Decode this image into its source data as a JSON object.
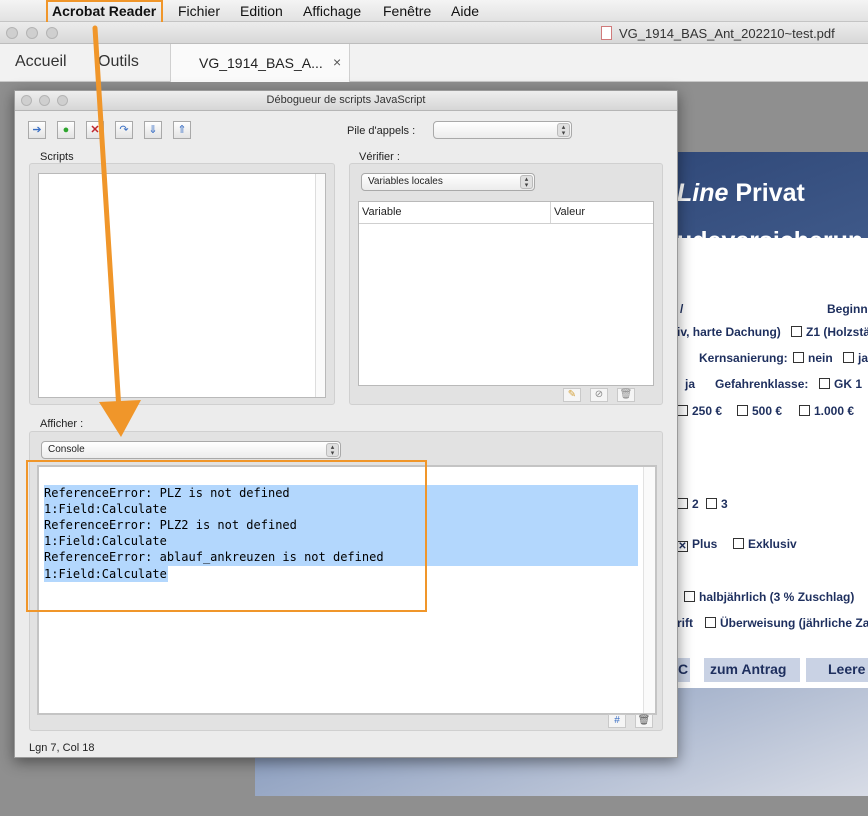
{
  "menubar": {
    "apple_icon": "apple-icon",
    "app_name": "Acrobat Reader",
    "items": [
      "Fichier",
      "Edition",
      "Affichage",
      "Fenêtre",
      "Aide"
    ]
  },
  "window": {
    "file_title": "VG_1914_BAS_Ant_202210~test.pdf"
  },
  "toolbar": {
    "home": "Accueil",
    "tools": "Outils",
    "doc_tab": "VG_1914_BAS_A...",
    "close": "×"
  },
  "debugger": {
    "title": "Débogueur de scripts JavaScript",
    "call_stack_label": "Pile d'appels :",
    "call_stack_value": "",
    "scripts_label": "Scripts",
    "verify_label": "Vérifier :",
    "verify_select": "Variables locales",
    "table_headers": [
      "Variable",
      "Valeur"
    ],
    "show_label": "Afficher :",
    "show_select": "Console",
    "console_lines": [
      "ReferenceError: PLZ is not defined",
      "1:Field:Calculate",
      "ReferenceError: PLZ2 is not defined",
      "1:Field:Calculate",
      "ReferenceError: ablauf_ankreuzen is not defined",
      "1:Field:Calculate"
    ],
    "status": "Lgn 7, Col 18"
  },
  "pdf": {
    "title1_italic": "Line",
    "title1_rest": " Privat",
    "title2": "udeversicherun",
    "row_slash": "/",
    "row_begin": "Beginn",
    "roof": "iv, harte Dachung)",
    "z1": "Z1 (Holzstä",
    "kern": "Kernsanierung:",
    "nein": "nein",
    "ja": "ja",
    "ja2": "ja",
    "gefahren": "Gefahrenklasse:",
    "gk1": "GK 1",
    "amt1": "250 €",
    "amt2": "500 €",
    "amt3": "1.000 €",
    "n2": "2",
    "n3": "3",
    "plus": "Plus",
    "exklusiv": "Exklusiv",
    "halbj": "halbjährlich (3 % Zuschlag)",
    "rift": "rift",
    "ueberweisung": "Überweisung (jährliche Za",
    "btn_c": "C",
    "btn_antrag": "zum Antrag",
    "btn_leere": "Leere"
  },
  "colors": {
    "highlight": "#f0962a",
    "selection": "#b3d7fd",
    "pdf_navy": "#1e2f5e"
  }
}
